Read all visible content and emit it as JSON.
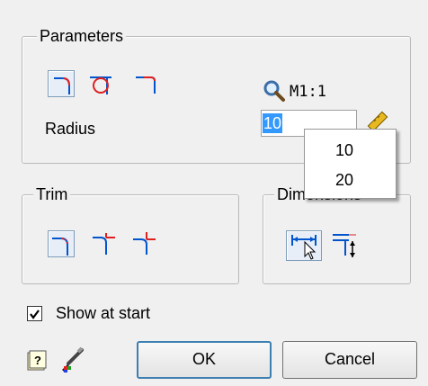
{
  "parameters": {
    "title": "Parameters",
    "scale_label": "M1:1",
    "radius_label": "Radius",
    "radius_value": "10",
    "tools": [
      "fillet-corner",
      "fillet-circle",
      "fillet-reverse"
    ]
  },
  "radius_dropdown": {
    "options": [
      "10",
      "20"
    ]
  },
  "trim": {
    "title": "Trim",
    "tools": [
      "trim-none",
      "trim-one",
      "trim-both"
    ]
  },
  "dimensions": {
    "title": "Dimensions",
    "tools": [
      "dimension-horizontal",
      "dimension-vertical"
    ]
  },
  "show_at_start": {
    "label": "Show at start",
    "checked": true
  },
  "footer": {
    "ok_label": "OK",
    "cancel_label": "Cancel"
  },
  "colors": {
    "accent": "#0055cc",
    "curve_red": "#e02020",
    "selection": "#3399ff"
  }
}
